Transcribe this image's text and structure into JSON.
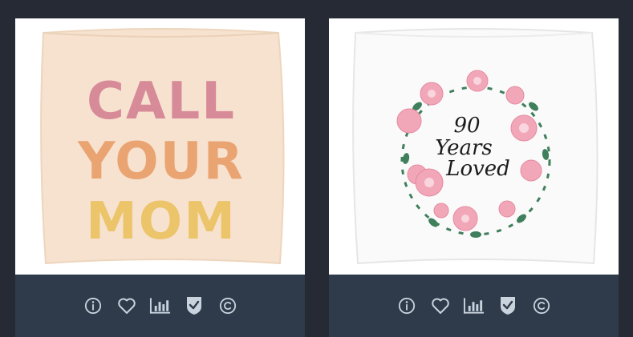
{
  "products": [
    {
      "pillow_text": [
        "CALL",
        "YOUR",
        "MOM"
      ],
      "colors": {
        "pillow": "#f6e2cf",
        "line1": "#d78a98",
        "line2": "#e9a472",
        "line3": "#ecc46a"
      },
      "actions": [
        "info-icon",
        "heart-icon",
        "chart-icon",
        "shield-check-icon",
        "copyright-icon"
      ]
    },
    {
      "pillow_text": [
        "90",
        "Years",
        "Loved"
      ],
      "colors": {
        "pillow": "#fafafa",
        "flower": "#f2a7b8",
        "leaf": "#3f7f5c",
        "text": "#1c1c1c"
      },
      "actions": [
        "info-icon",
        "heart-icon",
        "chart-icon",
        "shield-check-icon",
        "copyright-icon"
      ]
    }
  ],
  "theme": {
    "background": "#262a35",
    "card_footer": "#2f3b4a",
    "icon": "#c9d3de"
  }
}
